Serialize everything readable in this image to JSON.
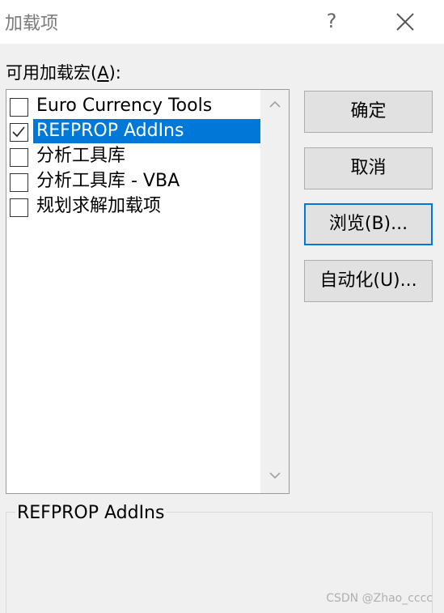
{
  "window": {
    "title": "加载项",
    "help_label": "?"
  },
  "addins_list": {
    "label_prefix": "可用加载宏(",
    "label_accel": "A",
    "label_suffix": "):",
    "items": [
      {
        "label": "Euro Currency Tools",
        "checked": false,
        "selected": false
      },
      {
        "label": "REFPROP AddIns",
        "checked": true,
        "selected": true
      },
      {
        "label": "分析工具库",
        "checked": false,
        "selected": false
      },
      {
        "label": "分析工具库 - VBA",
        "checked": false,
        "selected": false
      },
      {
        "label": "规划求解加载项",
        "checked": false,
        "selected": false
      }
    ]
  },
  "buttons": {
    "ok": "确定",
    "cancel": "取消",
    "browse": "浏览(B)...",
    "automation": "自动化(U)..."
  },
  "description": {
    "title": "REFPROP AddIns"
  },
  "watermark": "CSDN @Zhao_cccc",
  "colors": {
    "selection": "#0078d7",
    "dialog_bg": "#f0f0f0"
  }
}
